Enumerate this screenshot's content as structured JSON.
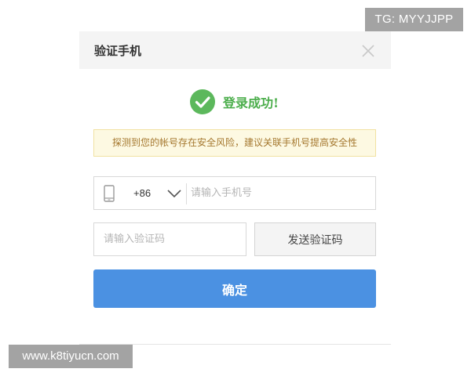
{
  "watermarks": {
    "top_right": "TG: MYYJJPP",
    "bottom_left": "www.k8tiyucn.com"
  },
  "dialog": {
    "title": "验证手机",
    "close_icon": "close-icon",
    "success": {
      "icon": "check-circle-icon",
      "icon_color": "#5cb85c",
      "text": "登录成功!"
    },
    "notice": "探测到您的帐号存在安全风险，建议关联手机号提高安全性",
    "phone": {
      "icon": "mobile-phone-icon",
      "country_code": "+86",
      "dropdown_icon": "chevron-down-icon",
      "placeholder": "请输入手机号",
      "value": ""
    },
    "code": {
      "placeholder": "请输入验证码",
      "value": ""
    },
    "send_code_label": "发送验证码",
    "confirm_label": "确定"
  },
  "colors": {
    "primary_button": "#4b91e2",
    "success_green": "#5cb85c",
    "notice_bg": "#fdf9e2",
    "notice_border": "#f1e2a2",
    "notice_text": "#a5782f",
    "header_bg": "#f4f4f4"
  }
}
